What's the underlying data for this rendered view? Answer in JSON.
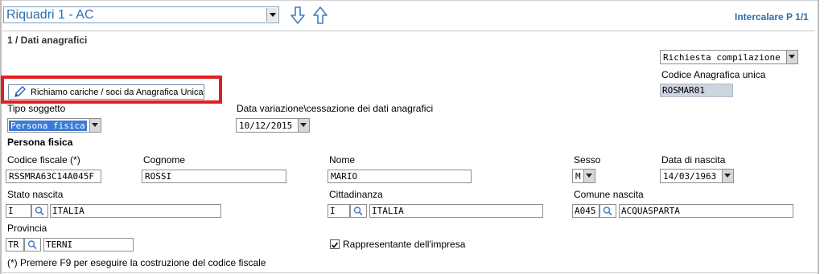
{
  "header": {
    "quadro_select_value": "Riquadri 1 - AC",
    "intercalare": "Intercalare P 1/1",
    "section_title": "1 / Dati anagrafici"
  },
  "richiesta": {
    "value": "Richiesta compilazione"
  },
  "codice_anagrafica": {
    "label": "Codice Anagrafica unica",
    "value": "ROSMAR01"
  },
  "richiamo_button": {
    "label": "Richiamo cariche / soci da Anagrafica Unica"
  },
  "tipo_soggetto": {
    "label": "Tipo soggetto",
    "value": "Persona fisica"
  },
  "data_variazione": {
    "label": "Data variazione\\cessazione dei dati anagrafici",
    "value": "10/12/2015"
  },
  "persona_fisica": {
    "heading": "Persona fisica",
    "codice_fiscale": {
      "label": "Codice fiscale (*)",
      "value": "RSSMRA63C14A045F"
    },
    "cognome": {
      "label": "Cognome",
      "value": "ROSSI"
    },
    "nome": {
      "label": "Nome",
      "value": "MARIO"
    },
    "sesso": {
      "label": "Sesso",
      "value": "M"
    },
    "data_nascita": {
      "label": "Data di nascita",
      "value": "14/03/1963"
    },
    "stato_nascita": {
      "label": "Stato nascita",
      "code": "I",
      "desc": "ITALIA"
    },
    "cittadinanza": {
      "label": "Cittadinanza",
      "code": "I",
      "desc": "ITALIA"
    },
    "comune_nascita": {
      "label": "Comune nascita",
      "code": "A045",
      "desc": "ACQUASPARTA"
    },
    "provincia": {
      "label": "Provincia",
      "code": "TR",
      "desc": "TERNI"
    },
    "rappresentante": {
      "label": "Rappresentante dell'impresa",
      "checked": true
    }
  },
  "footnote": "(*) Premere F9 per eseguire la costruzione del codice fiscale",
  "colors": {
    "accent": "#2b6fb0",
    "highlight_border": "#e11f1f",
    "selection": "#3a7bd5",
    "readonly_bg": "#ccd5e0"
  }
}
